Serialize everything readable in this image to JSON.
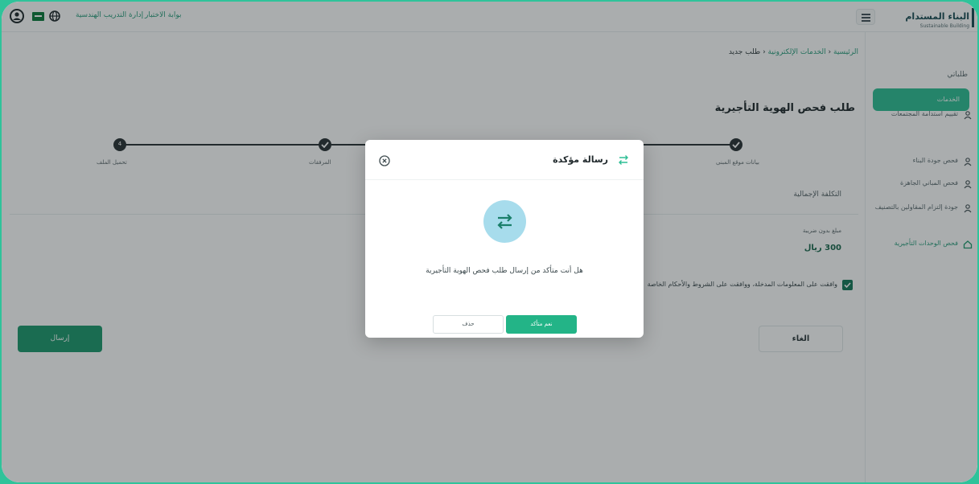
{
  "topbar": {
    "link_training": "إدارة التدريب الهندسية",
    "link_exams": "بوابة الاختبار",
    "logo_ar": "البناء المستدام",
    "logo_en": "Sustainable Building"
  },
  "sidebar": {
    "heading": "طلباتي",
    "active_item": "الخدمات",
    "items": [
      "تقييم استدامة المجتمعات",
      "فحص جودة البناء",
      "فحص المباني الجاهزة",
      "جودة إلتزام المقاولين بالتصنيف",
      "فحص الوحدات التأجيرية"
    ]
  },
  "breadcrumb": {
    "home": "الرئيسية",
    "services": "الخدمات الإلكترونية",
    "current": "طلب جديد",
    "separator": "‹"
  },
  "page": {
    "title": "طلب فحص الهوية التأجيرية",
    "steps": [
      {
        "label": "بيانات موقع المبنى",
        "state": "done"
      },
      {
        "label": "",
        "state": "done"
      },
      {
        "label": "المرفقات",
        "state": "done"
      },
      {
        "label": "تحميل الملف",
        "state": "current",
        "number": "4"
      }
    ],
    "cost_title": "التكلفة الإجمالية",
    "price_label": "مبلغ بدون ضريبة",
    "price_value": "300 ريال",
    "agree_text": "وافقت على المعلومات المدخلة، ووافقت على  الشروط والأحكام الخاصة",
    "send_button": "إرسال",
    "cancel_button": "الغاء"
  },
  "modal": {
    "title": "رسالة مؤكدة",
    "message": "هل أنت متأكد من إرسال طلب فحص الهوية التأجيرية",
    "confirm_button": "نعم متأكد",
    "cancel_button": "حذف"
  },
  "colors": {
    "brand_green": "#2fbf95",
    "dark_green": "#1e9a6e",
    "dark": "#2b3336",
    "modal_icon_bg": "#a7dcec"
  }
}
